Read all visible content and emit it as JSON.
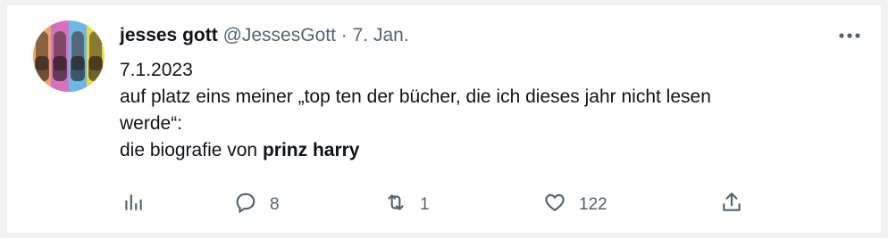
{
  "tweet": {
    "author": {
      "display_name": "jesses gott",
      "handle": "@JessesGott",
      "separator": "·",
      "date": "7. Jan."
    },
    "more_icon": "more-dots-icon",
    "text": {
      "line1": "7.1.2023",
      "line2": "auf platz eins meiner „top ten der bücher, die ich dieses jahr nicht lesen",
      "line3": "werde“:",
      "line4_prefix": "die biografie von ",
      "line4_bold": "prinz harry"
    },
    "actions": {
      "views_icon": "analytics-icon",
      "reply_icon": "reply-icon",
      "reply_count": "8",
      "retweet_icon": "retweet-icon",
      "retweet_count": "1",
      "like_icon": "heart-icon",
      "like_count": "122",
      "share_icon": "share-icon"
    }
  }
}
